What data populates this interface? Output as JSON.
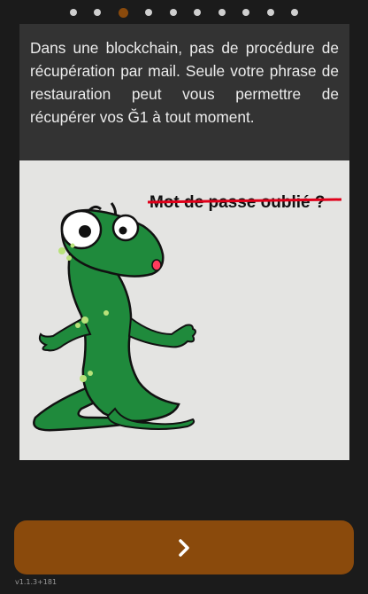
{
  "pager": {
    "total": 10,
    "active_index": 2
  },
  "slide": {
    "text": "Dans une blockchain, pas de procédure de récupération par mail. Seule votre phrase de restauration peut vous permettre de récupérer vos Ğ1 à tout moment.",
    "image_caption": "Mot de passe oublié ?"
  },
  "next_button": {
    "icon": "chevron-right-icon"
  },
  "footer": {
    "version": "v1.1.3+181"
  },
  "colors": {
    "accent": "#8a4a0c",
    "card": "#333333",
    "background": "#1b1b1b",
    "strike": "#e0001a",
    "gecko": "#1f8a3c"
  }
}
